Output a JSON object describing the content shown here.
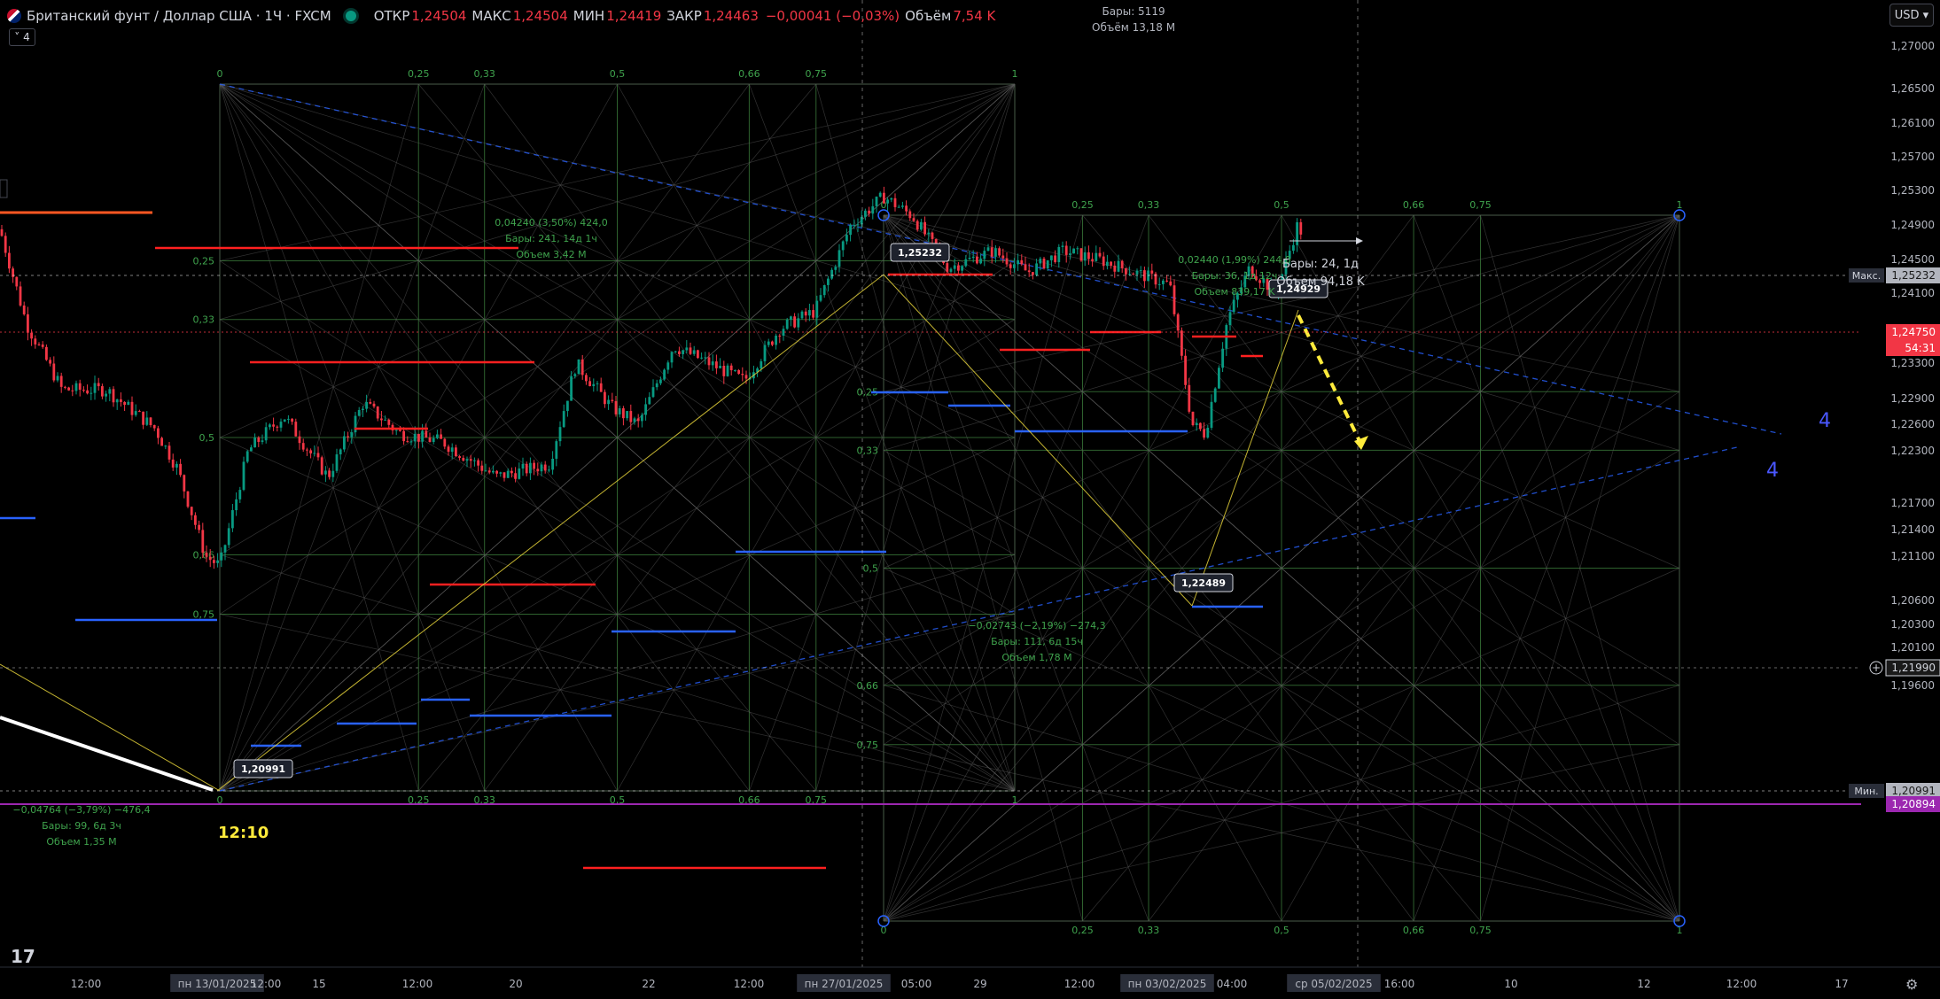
{
  "header": {
    "symbol": "Британский фунт / Доллар США · 1Ч · FXCM",
    "open_label": "ОТКР",
    "open": "1,24504",
    "high_label": "МАКС",
    "high": "1,24504",
    "low_label": "МИН",
    "low": "1,24419",
    "close_label": "ЗАКР",
    "close": "1,24463",
    "change": "−0,00041 (−0,03%)",
    "volume_label": "Объём",
    "volume": "7,54 K",
    "indicator_count": "4",
    "currency": "USD",
    "bars_info": "Бары: 5119",
    "volume_info": "Объём 13,18 M"
  },
  "colors": {
    "up": "#089981",
    "down": "#f23645",
    "grid_green": "#3a7a3a",
    "res_red": "#ff2020",
    "sup_blue": "#2962ff",
    "yellow": "#ffeb3b",
    "purple": "#9c27b0"
  },
  "icons": [
    "gbp-usd-flag-icon",
    "market-open-dot-icon",
    "tradingview-logo-icon",
    "settings-gear-icon"
  ],
  "chart_data": {
    "type": "candlestick",
    "y_axis_ticks": [
      "1,27000",
      "1,26500",
      "1,26100",
      "1,25700",
      "1,25300",
      "1,24900",
      "1,24500",
      "1,24100",
      "1,23700",
      "1,23300",
      "1,22900",
      "1,22600",
      "1,22300",
      "1,21700",
      "1,21400",
      "1,21100",
      "1,20600",
      "1,20300",
      "1,20100",
      "1,19880",
      "1,19600"
    ],
    "y_ticks_values": [
      1.27,
      1.265,
      1.261,
      1.257,
      1.253,
      1.249,
      1.245,
      1.241,
      1.237,
      1.233,
      1.229,
      1.226,
      1.223,
      1.217,
      1.214,
      1.211,
      1.206,
      1.203,
      1.201,
      1.1988,
      1.196
    ],
    "price_tags": [
      {
        "label": "Макс.",
        "value": "1,25232"
      },
      {
        "label": "",
        "value": "1,24750",
        "sub": "54:31"
      },
      {
        "label": "",
        "value": "1,21990"
      },
      {
        "label": "Мин.",
        "value": "1,20991"
      },
      {
        "label": "",
        "value": "1,20894"
      }
    ],
    "x_axis_labels": [
      "12:00",
      "пн 13/01/2025",
      "12:00",
      "15",
      "12:00",
      "20",
      "22",
      "12:00",
      "пн 27/01/2025",
      "05:00",
      "29",
      "12:00",
      "пн 03/02/2025",
      "04:00",
      "ср 05/02/2025",
      "16:00",
      "10",
      "12",
      "12:00",
      "17"
    ],
    "annotations": {
      "hi": "1,25232",
      "lo1": "1,20991",
      "lo2": "1,22489",
      "hi2": "1,24929",
      "m1a": "0,04240 (3,50%) 424,0",
      "m1b": "Бары: 241, 14д 1ч",
      "m1c": "Объем 3,42 M",
      "m2a": "−0,02743 (−2,19%) −274,3",
      "m2b": "Бары: 111, 6д 15ч",
      "m2c": "Объем 1,78 M",
      "m3a": "0,02440 (1,99%) 244,0",
      "m3b": "Бары: 36, 1д 12ч",
      "m3c": "Объем 839,17 K",
      "m4a": "−0,04764 (−3,79%) −476,4",
      "m4b": "Бары: 99, 6д 3ч",
      "m4c": "Объем 1,35 M",
      "proj_a": "Бары: 24, 1д",
      "proj_b": "Объем 94,18 K",
      "wave1": "4",
      "wave2": "4",
      "time": "12:10",
      "fan_levels": [
        "0",
        "0,25",
        "0,33",
        "0,5",
        "0,66",
        "0,75",
        "1"
      ]
    }
  }
}
